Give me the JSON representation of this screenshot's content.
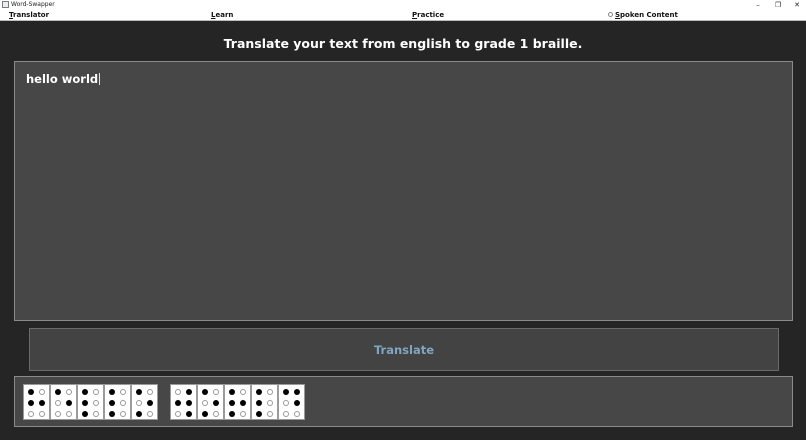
{
  "window": {
    "title": "Word-Swapper",
    "controls": [
      "–",
      "❐",
      "✕"
    ]
  },
  "menu": {
    "items": [
      {
        "id": "translator",
        "accel": "T",
        "rest": "ranslator"
      },
      {
        "id": "learn",
        "accel": "L",
        "rest": "earn"
      },
      {
        "id": "practice",
        "accel": "P",
        "rest": "ractice"
      },
      {
        "id": "spoken-content",
        "accel": "S",
        "rest": "poken Content"
      }
    ]
  },
  "heading": "Translate your text from english to grade 1 braille.",
  "input": {
    "value": "hello world"
  },
  "translate_button": "Translate",
  "braille": {
    "words": [
      {
        "letters": [
          {
            "char": "h",
            "dots": [
              1,
              2,
              5
            ]
          },
          {
            "char": "e",
            "dots": [
              1,
              5
            ]
          },
          {
            "char": "l",
            "dots": [
              1,
              2,
              3
            ]
          },
          {
            "char": "l",
            "dots": [
              1,
              2,
              3
            ]
          },
          {
            "char": "o",
            "dots": [
              1,
              3,
              5
            ]
          }
        ]
      },
      {
        "letters": [
          {
            "char": "w",
            "dots": [
              2,
              4,
              5,
              6
            ]
          },
          {
            "char": "o",
            "dots": [
              1,
              3,
              5
            ]
          },
          {
            "char": "r",
            "dots": [
              1,
              2,
              3,
              5
            ]
          },
          {
            "char": "l",
            "dots": [
              1,
              2,
              3
            ]
          },
          {
            "char": "d",
            "dots": [
              1,
              4,
              5
            ]
          }
        ]
      }
    ]
  }
}
